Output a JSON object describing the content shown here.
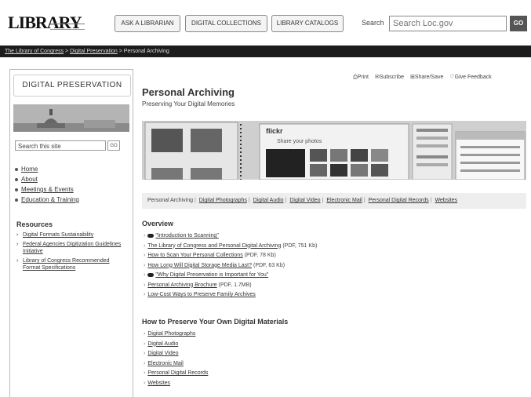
{
  "header": {
    "logo": "LIBRARY",
    "nav": [
      "ASK A LIBRARIAN",
      "DIGITAL COLLECTIONS",
      "LIBRARY CATALOGS"
    ],
    "search_label": "Search",
    "search_placeholder": "Search Loc.gov",
    "search_go": "GO"
  },
  "breadcrumb": {
    "items": [
      "The Library of Congress",
      "Digital Preservation"
    ],
    "separator": ">",
    "current": "Personal Archiving"
  },
  "sidebar": {
    "title": "DIGITAL PRESERVATION",
    "search_placeholder": "Search this site",
    "search_go": "GO",
    "nav": [
      "Home",
      "About",
      "Meetings & Events",
      "Education & Training"
    ],
    "resources_title": "Resources",
    "resources": [
      "Digital Formats Sustainability",
      "Federal Agencies Digitization Guidelines Initiative",
      "Library of Congress Recommended Format Specifications"
    ]
  },
  "tools": [
    "Print",
    "Subscribe",
    "Share/Save",
    "Give Feedback"
  ],
  "main": {
    "title": "Personal Archiving",
    "subtitle": "Preserving Your Digital Memories",
    "tabs": [
      "Personal Archiving",
      "Digital Photographs",
      "Digital Audio",
      "Digital Video",
      "Electronic Mail",
      "Personal Digital Records",
      "Websites"
    ]
  },
  "overview": {
    "title": "Overview",
    "items": [
      {
        "icon": true,
        "text": "\"Introduction to Scanning\"",
        "suffix": ""
      },
      {
        "icon": false,
        "text": "The Library of Congress and Personal Digital Archiving",
        "suffix": "(PDF, 751 Kb)"
      },
      {
        "icon": false,
        "text": "How to Scan Your Personal Collections",
        "suffix": "(PDF, 78 Kb)"
      },
      {
        "icon": false,
        "text": "How Long Will Digital Storage Media Last?",
        "suffix": "(PDF, 63 Kb)"
      },
      {
        "icon": true,
        "text": "\"Why Digital Preservation is Important for You\"",
        "suffix": ""
      },
      {
        "icon": false,
        "text": "Personal Archiving Brochure",
        "suffix": "(PDF, 1.7MB)"
      },
      {
        "icon": false,
        "text": "Low-Cost Ways to Preserve Family Archives",
        "suffix": ""
      }
    ]
  },
  "how_to": {
    "title": "How to Preserve Your Own Digital Materials",
    "items": [
      "Digital Photographs",
      "Digital Audio",
      "Digital Video",
      "Electronic Mail",
      "Personal Digital Records",
      "Websites"
    ]
  },
  "banner": {
    "flickr_logo": "flickr",
    "flickr_tagline": "Share your photos"
  }
}
